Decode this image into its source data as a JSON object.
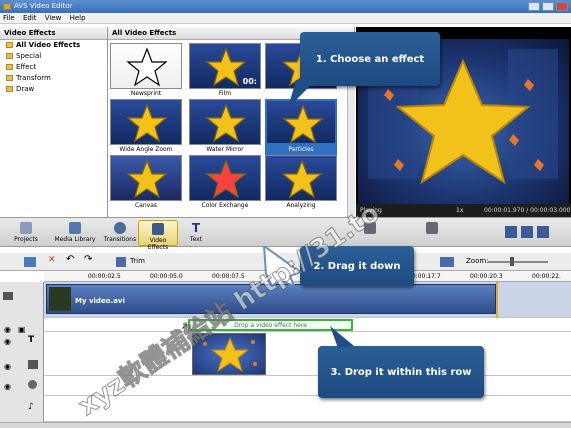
{
  "window": {
    "title": "AVS Video Editor"
  },
  "menu": [
    "File",
    "Edit",
    "View",
    "Help"
  ],
  "tree": {
    "header": "Video Effects",
    "items": [
      "All Video Effects",
      "Special",
      "Effect",
      "Transform",
      "Draw"
    ]
  },
  "gallery": {
    "header": "All Video Effects",
    "effects": [
      "Newsprint",
      "Film",
      "",
      "Wide Angle Zoom",
      "Water Mirror",
      "Particles",
      "Canvas",
      "Color Exchange",
      "Analyzing"
    ],
    "film_overlay": "00:"
  },
  "preview": {
    "status": "Playing",
    "speed": "1x",
    "time": "00:00:01.970 / 00:00:03.000"
  },
  "tabs": [
    "Projects",
    "Media Library",
    "Transitions",
    "Video Effects",
    "Text",
    "",
    ""
  ],
  "timeline_toolbar": {
    "trim": "Trim",
    "zoom_label": "Zoom:"
  },
  "ruler": [
    "00:00:02.5",
    "00:00:05.0",
    "00:00:07.5",
    "00:00:17.7",
    "00:00:20.3",
    "00:00:22."
  ],
  "timeline": {
    "clip_name": "My video.avi",
    "drop_hint": "Drop a video effect here"
  },
  "callouts": {
    "step1": "1. Choose an effect",
    "step2": "2. Drag it down",
    "step3": "3. Drop it within this row"
  },
  "watermark": "xyz軟體補給站 http://31.to",
  "colors": {
    "accent": "#3070c0",
    "callout": "#1f4d86",
    "drop_border": "#3cb043"
  }
}
